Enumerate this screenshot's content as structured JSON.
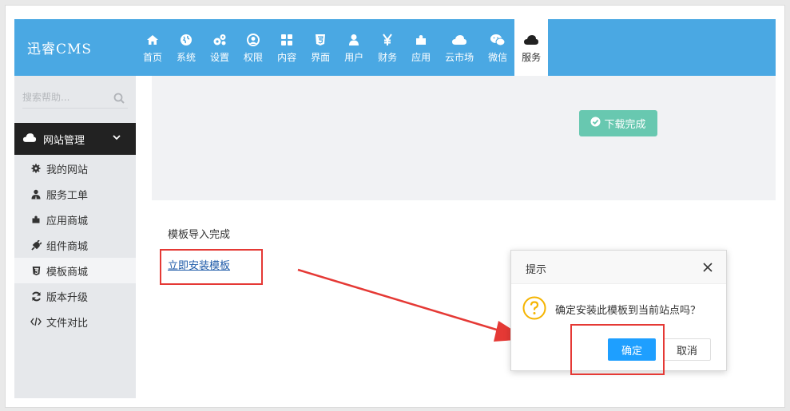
{
  "app": {
    "logo": "迅睿CMS"
  },
  "nav": [
    {
      "label": "首页",
      "icon": "home-icon"
    },
    {
      "label": "系统",
      "icon": "globe-icon"
    },
    {
      "label": "设置",
      "icon": "cogs-icon"
    },
    {
      "label": "权限",
      "icon": "user-circle-icon"
    },
    {
      "label": "内容",
      "icon": "grid-icon"
    },
    {
      "label": "界面",
      "icon": "html5-icon"
    },
    {
      "label": "用户",
      "icon": "user-icon"
    },
    {
      "label": "财务",
      "icon": "yen-icon"
    },
    {
      "label": "应用",
      "icon": "puzzle-icon"
    },
    {
      "label": "云市场",
      "icon": "cloud-icon"
    },
    {
      "label": "微信",
      "icon": "wechat-icon"
    },
    {
      "label": "服务",
      "icon": "cloud-dark-icon",
      "active": true
    }
  ],
  "sidebar": {
    "search_placeholder": "搜索帮助...",
    "group_label": "网站管理",
    "items": [
      {
        "label": "我的网站",
        "icon": "gear-icon"
      },
      {
        "label": "服务工单",
        "icon": "user-tie-icon"
      },
      {
        "label": "应用商城",
        "icon": "puzzle-icon"
      },
      {
        "label": "组件商城",
        "icon": "plug-icon"
      },
      {
        "label": "模板商城",
        "icon": "html5-icon",
        "active": true
      },
      {
        "label": "版本升级",
        "icon": "refresh-icon"
      },
      {
        "label": "文件对比",
        "icon": "code-icon"
      }
    ]
  },
  "main": {
    "download_label": "下载完成",
    "message": "模板导入完成",
    "install_link": "立即安装模板"
  },
  "dialog": {
    "title": "提示",
    "text": "确定安装此模板到当前站点吗？",
    "ok_label": "确定",
    "cancel_label": "取消"
  },
  "colors": {
    "header": "#4aa8e3",
    "download_button": "#68c8b0",
    "primary_button": "#1e9fff",
    "annotation_red": "#e53935",
    "question_icon": "#f5b400"
  }
}
